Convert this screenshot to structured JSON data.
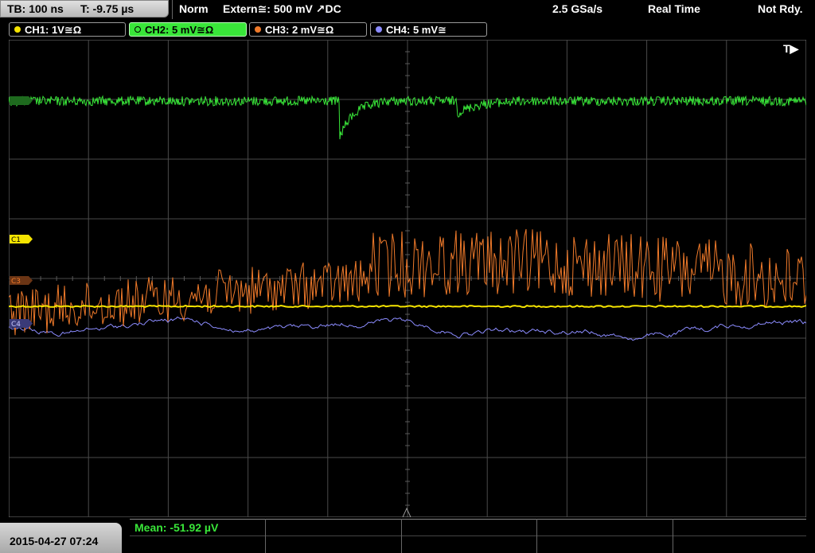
{
  "header": {
    "timebase": "TB: 100 ns",
    "trigger_time": "T: -9.75 µs",
    "acq_mode": "Norm",
    "trigger_source": "Extern≅: 500 mV ↗DC",
    "sample_rate": "2.5 GSa/s",
    "realtime": "Real Time",
    "status": "Not Rdy."
  },
  "channels": [
    {
      "label": "CH1: 1V≅Ω",
      "color": "#f5e400"
    },
    {
      "label": "CH2: 5 mV≅Ω",
      "color": "#39e639"
    },
    {
      "label": "CH3: 2 mV≅Ω",
      "color": "#f07a2a"
    },
    {
      "label": "CH4: 5 mV≅",
      "color": "#8c8cff"
    }
  ],
  "markers": {
    "c1": "C1",
    "c3": "C3",
    "c4": "C4",
    "trigger_flag": "T▶"
  },
  "footer": {
    "datetime": "2015-04-27 07:24",
    "measurement": "Mean: -51.92 µV"
  },
  "colors": {
    "ch1": "#f5e400",
    "ch2": "#39e639",
    "ch3": "#f07a2a",
    "ch4": "#8c8cff",
    "grid": "#4a4a4a"
  }
}
